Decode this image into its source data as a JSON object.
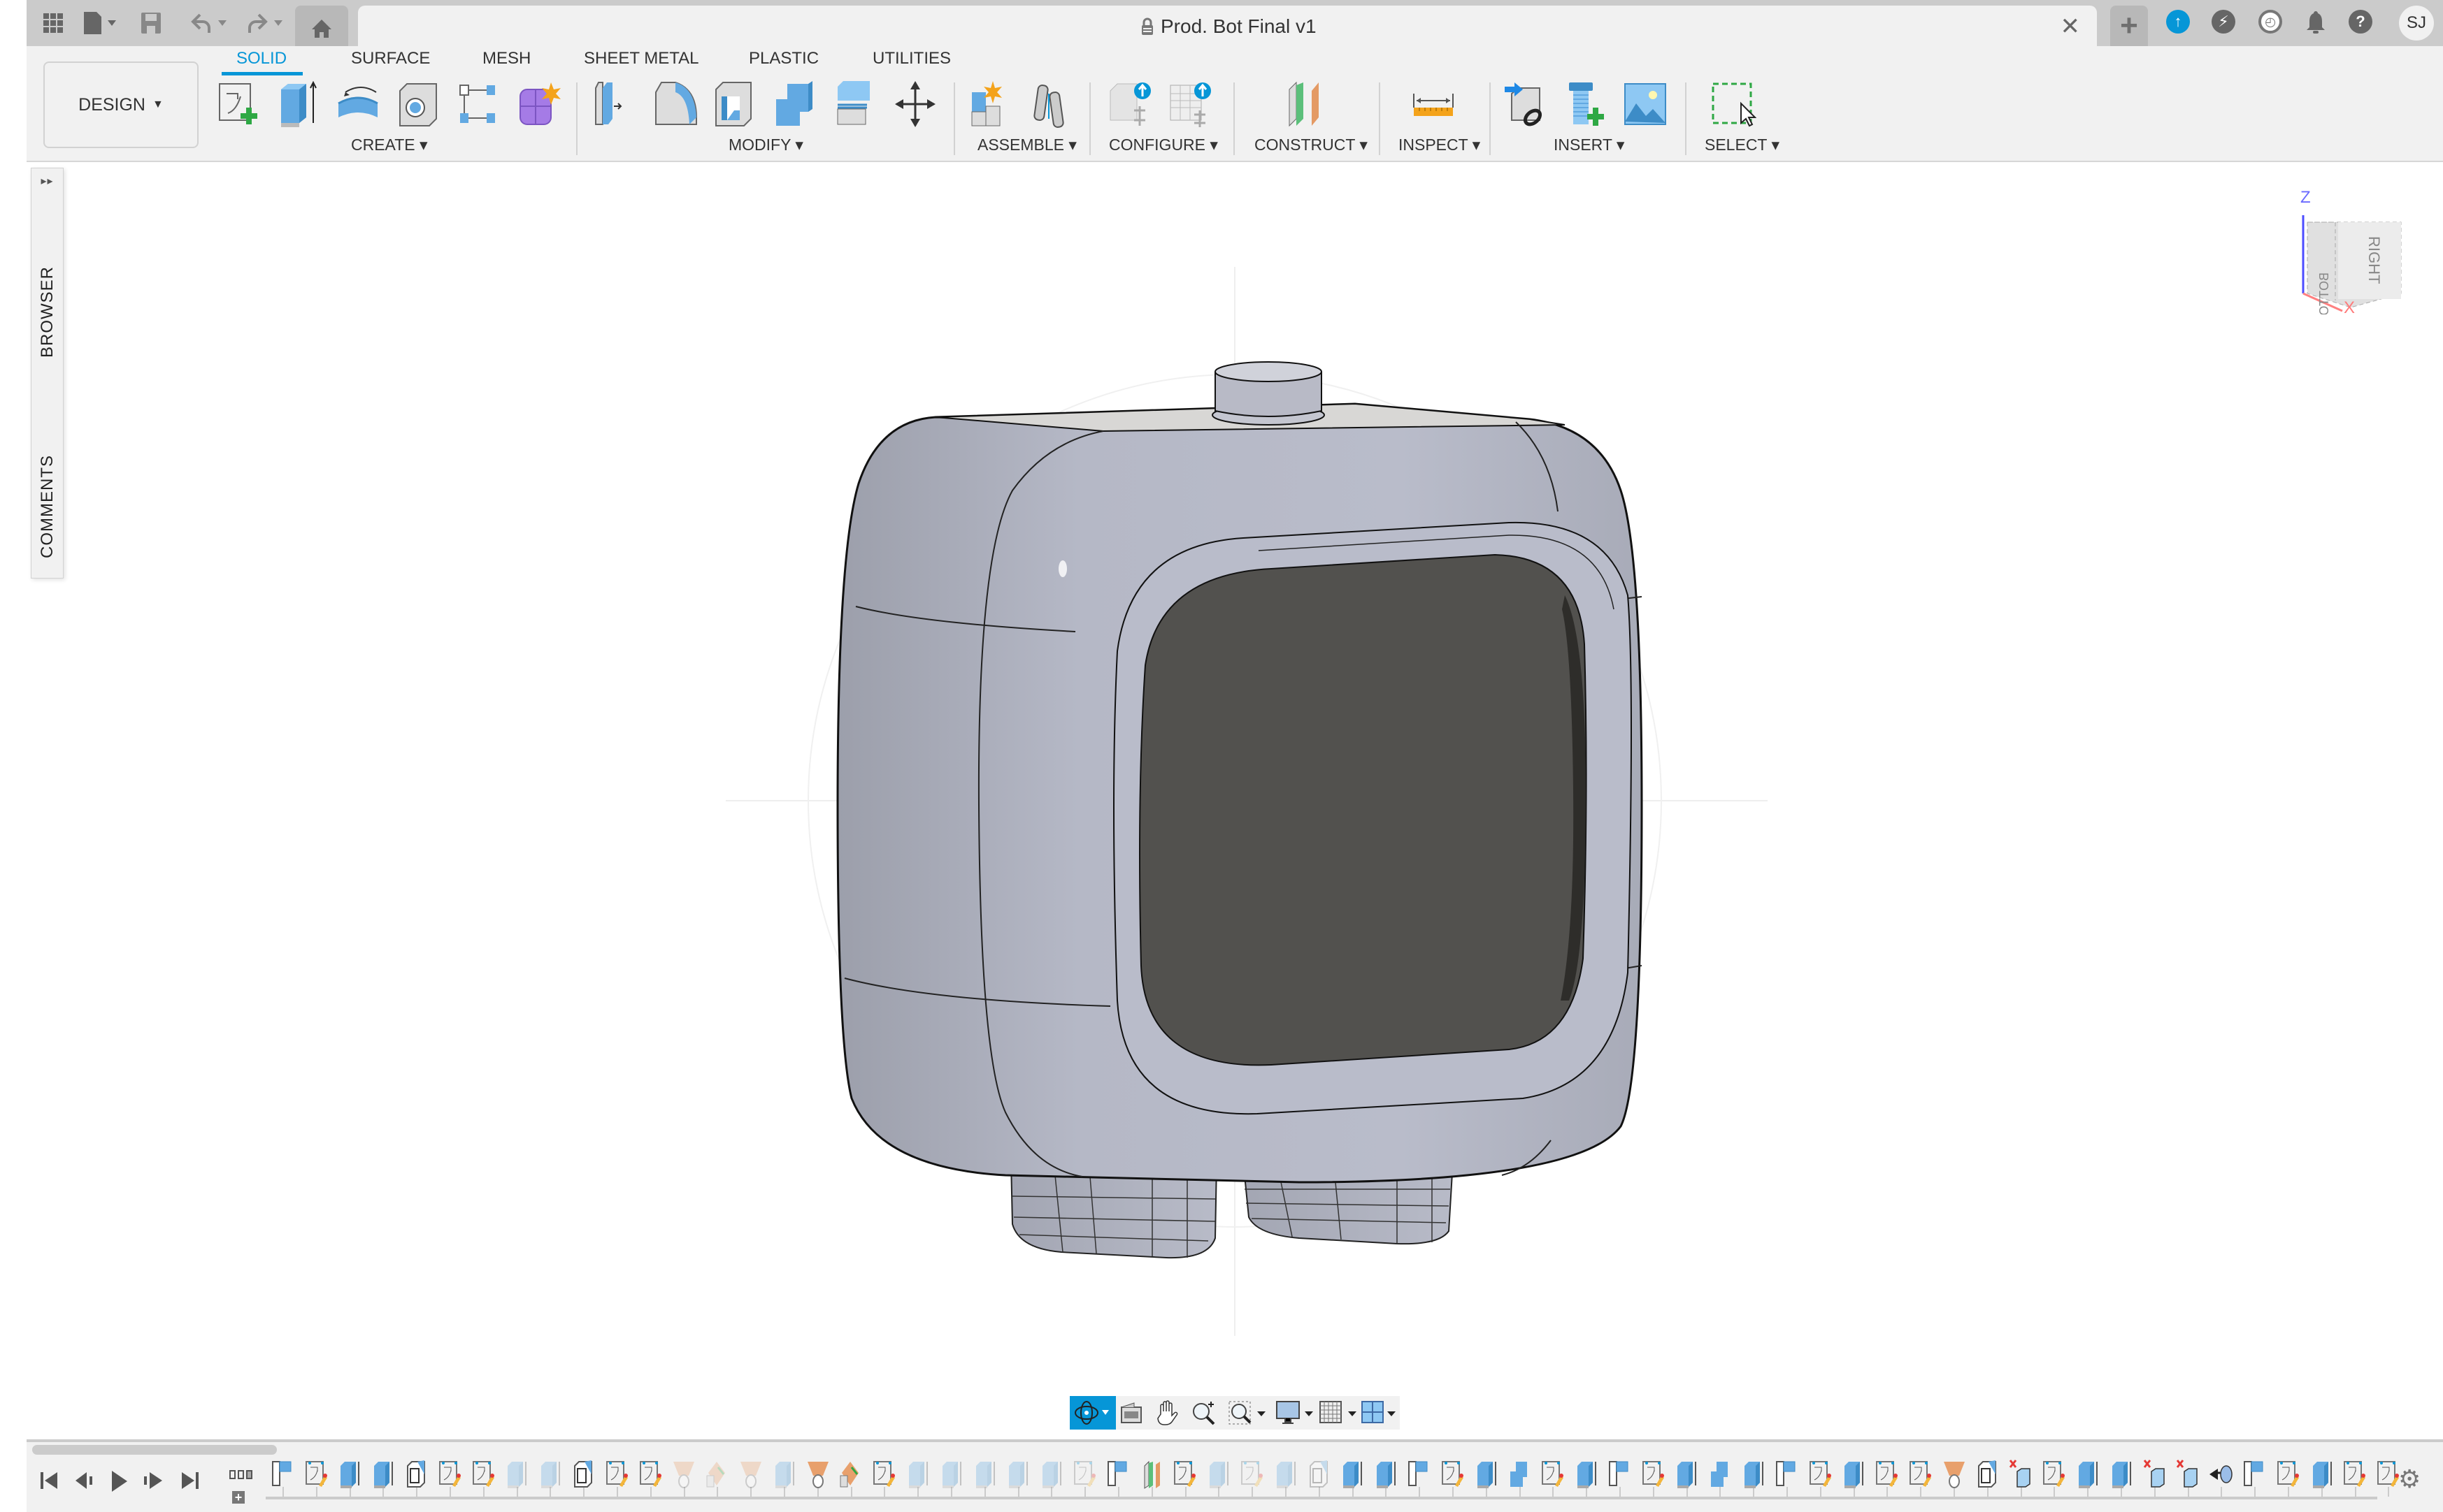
{
  "app": {
    "document_title": "Prod. Bot Final v1",
    "user_initials": "SJ",
    "appbar_icons": [
      "apps-grid-icon",
      "file-icon",
      "save-icon",
      "undo-icon",
      "redo-icon",
      "home-icon"
    ],
    "status_icons": [
      "job-status-icon",
      "extensions-icon",
      "history-icon",
      "notifications-icon",
      "help-icon"
    ]
  },
  "toolbar": {
    "workspace": "DESIGN",
    "tabs": [
      {
        "label": "SOLID",
        "active": true
      },
      {
        "label": "SURFACE",
        "active": false
      },
      {
        "label": "MESH",
        "active": false
      },
      {
        "label": "SHEET METAL",
        "active": false
      },
      {
        "label": "PLASTIC",
        "active": false
      },
      {
        "label": "UTILITIES",
        "active": false
      }
    ],
    "groups": [
      {
        "label": "CREATE ▾",
        "tools": [
          "create-sketch",
          "extrude",
          "revolve",
          "hole",
          "pattern",
          "create-form"
        ]
      },
      {
        "label": "MODIFY ▾",
        "tools": [
          "press-pull",
          "fillet",
          "shell",
          "combine",
          "offset-face",
          "move-copy"
        ]
      },
      {
        "label": "ASSEMBLE ▾",
        "tools": [
          "new-component",
          "joint"
        ]
      },
      {
        "label": "CONFIGURE ▾",
        "tools": [
          "configure-design",
          "configuration-table"
        ]
      },
      {
        "label": "CONSTRUCT ▾",
        "tools": [
          "offset-plane"
        ]
      },
      {
        "label": "INSPECT ▾",
        "tools": [
          "measure"
        ]
      },
      {
        "label": "INSERT ▾",
        "tools": [
          "insert-derive",
          "insert-mcmaster",
          "insert-canvas"
        ]
      },
      {
        "label": "SELECT ▾",
        "tools": [
          "window-select"
        ]
      }
    ]
  },
  "side_panel": {
    "browser": "BROWSER",
    "comments": "COMMENTS"
  },
  "viewcube": {
    "top_axis": "Z",
    "bottom_axis": "X",
    "face_right": "RIGHT",
    "face_left": "BOTTOM"
  },
  "model": {
    "body_color": "#b4b7c4",
    "screen_color": "#52514e"
  },
  "navbar": {
    "tools": [
      "orbit",
      "look-at",
      "pan",
      "zoom",
      "zoom-window",
      "display-settings",
      "grid-settings",
      "viewports"
    ]
  },
  "timeline": {
    "controls": [
      "go-to-start",
      "step-back",
      "play",
      "step-forward",
      "go-to-end"
    ],
    "features": [
      "component",
      "sketch",
      "extrude",
      "extrude",
      "shell",
      "sketch",
      "sketch",
      "extrude-suppressed",
      "extrude-suppressed",
      "shell",
      "sketch",
      "sketch",
      "loft-suppressed",
      "split-suppressed",
      "loft-suppressed",
      "extrude-suppressed",
      "loft",
      "split",
      "sketch",
      "extrude-suppressed",
      "extrude-suppressed",
      "extrude-suppressed",
      "extrude-suppressed",
      "extrude-suppressed",
      "sketch-suppressed",
      "component",
      "plane",
      "sketch",
      "extrude-suppressed",
      "sketch-suppressed",
      "extrude-suppressed",
      "shell-suppressed",
      "extrude",
      "extrude",
      "component",
      "sketch",
      "extrude",
      "combine",
      "sketch",
      "extrude",
      "component",
      "sketch",
      "extrude",
      "combine",
      "extrude",
      "component",
      "sketch",
      "extrude",
      "sketch",
      "sketch",
      "loft",
      "shell",
      "remove",
      "sketch",
      "extrude",
      "extrude",
      "remove",
      "remove",
      "move",
      "component",
      "sketch",
      "extrude",
      "sketch",
      "sketch"
    ]
  }
}
